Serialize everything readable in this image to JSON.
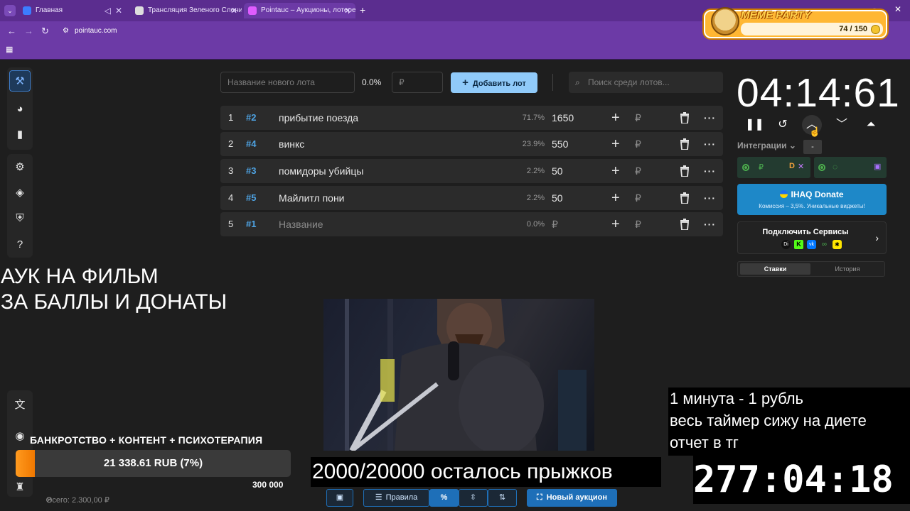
{
  "browser": {
    "tabs": [
      {
        "title": "Главная",
        "fav_color": "#3c7dff"
      },
      {
        "title": "Трансляция Зеленого Слоника",
        "fav_color": "#dddddd"
      },
      {
        "title": "Pointauc – Аукционы, лотереи",
        "fav_color": "#e05cff"
      }
    ],
    "url": "pointauc.com"
  },
  "meme_party": {
    "title": "MEME PARTY",
    "count": "74 / 150"
  },
  "lot_form": {
    "name_placeholder": "Название нового лота",
    "percent": "0.0%",
    "amount_placeholder": "₽",
    "add_button": "Добавить лот",
    "search_placeholder": "Поиск среди лотов..."
  },
  "lots": [
    {
      "num": "1",
      "id": "#2",
      "name": "прибытие поезда",
      "pct": "71.7%",
      "amount": "1650"
    },
    {
      "num": "2",
      "id": "#4",
      "name": "винкс",
      "pct": "23.9%",
      "amount": "550"
    },
    {
      "num": "3",
      "id": "#3",
      "name": "помидоры убийцы",
      "pct": "2.2%",
      "amount": "50"
    },
    {
      "num": "4",
      "id": "#5",
      "name": "Майлитл пони",
      "pct": "2.2%",
      "amount": "50"
    },
    {
      "num": "5",
      "id": "#1",
      "name": "Название",
      "pct": "0.0%",
      "amount": "₽"
    }
  ],
  "lot_row_labels": {
    "rub": "₽",
    "plus": "+",
    "more": "···"
  },
  "timer": {
    "value": "04:14:61",
    "tooltip": "-"
  },
  "integrations": {
    "label": "Интеграции",
    "rub": "₽"
  },
  "donate": {
    "title": "IHAQ Donate",
    "subtitle": "Комиссия – 3,5%. Уникальные виджеты!"
  },
  "services": {
    "title": "Подключить Сервисы"
  },
  "history_tabs": {
    "bids": "Ставки",
    "history": "История"
  },
  "overlays": {
    "auction_line1": "АУК НА ФИЛЬМ",
    "auction_line2": "ЗА БАЛЛЫ И ДОНАТЫ",
    "jumps": "2000/20000 осталось прыжков",
    "diet_line1": "1 минута - 1 рубль",
    "diet_line2": "весь таймер сижу на диете",
    "diet_line3": "отчет в тг",
    "big_timer": "277:04:18"
  },
  "goal": {
    "title": "БАНКРОТСТВО + КОНТЕНТ + ПСИХОТЕРАПИЯ",
    "progress_text": "21 338.61 RUB (7%)",
    "progress_fraction": 0.07,
    "target": "300 000",
    "total": "Всего: 2.300,00 ₽"
  },
  "toolbar": {
    "rules": "Правила",
    "percent": "%",
    "new_auction": "Новый аукцион"
  },
  "colors": {
    "accent": "#90caf9",
    "browser": "#6c3aa6",
    "goal": "#f07800"
  }
}
